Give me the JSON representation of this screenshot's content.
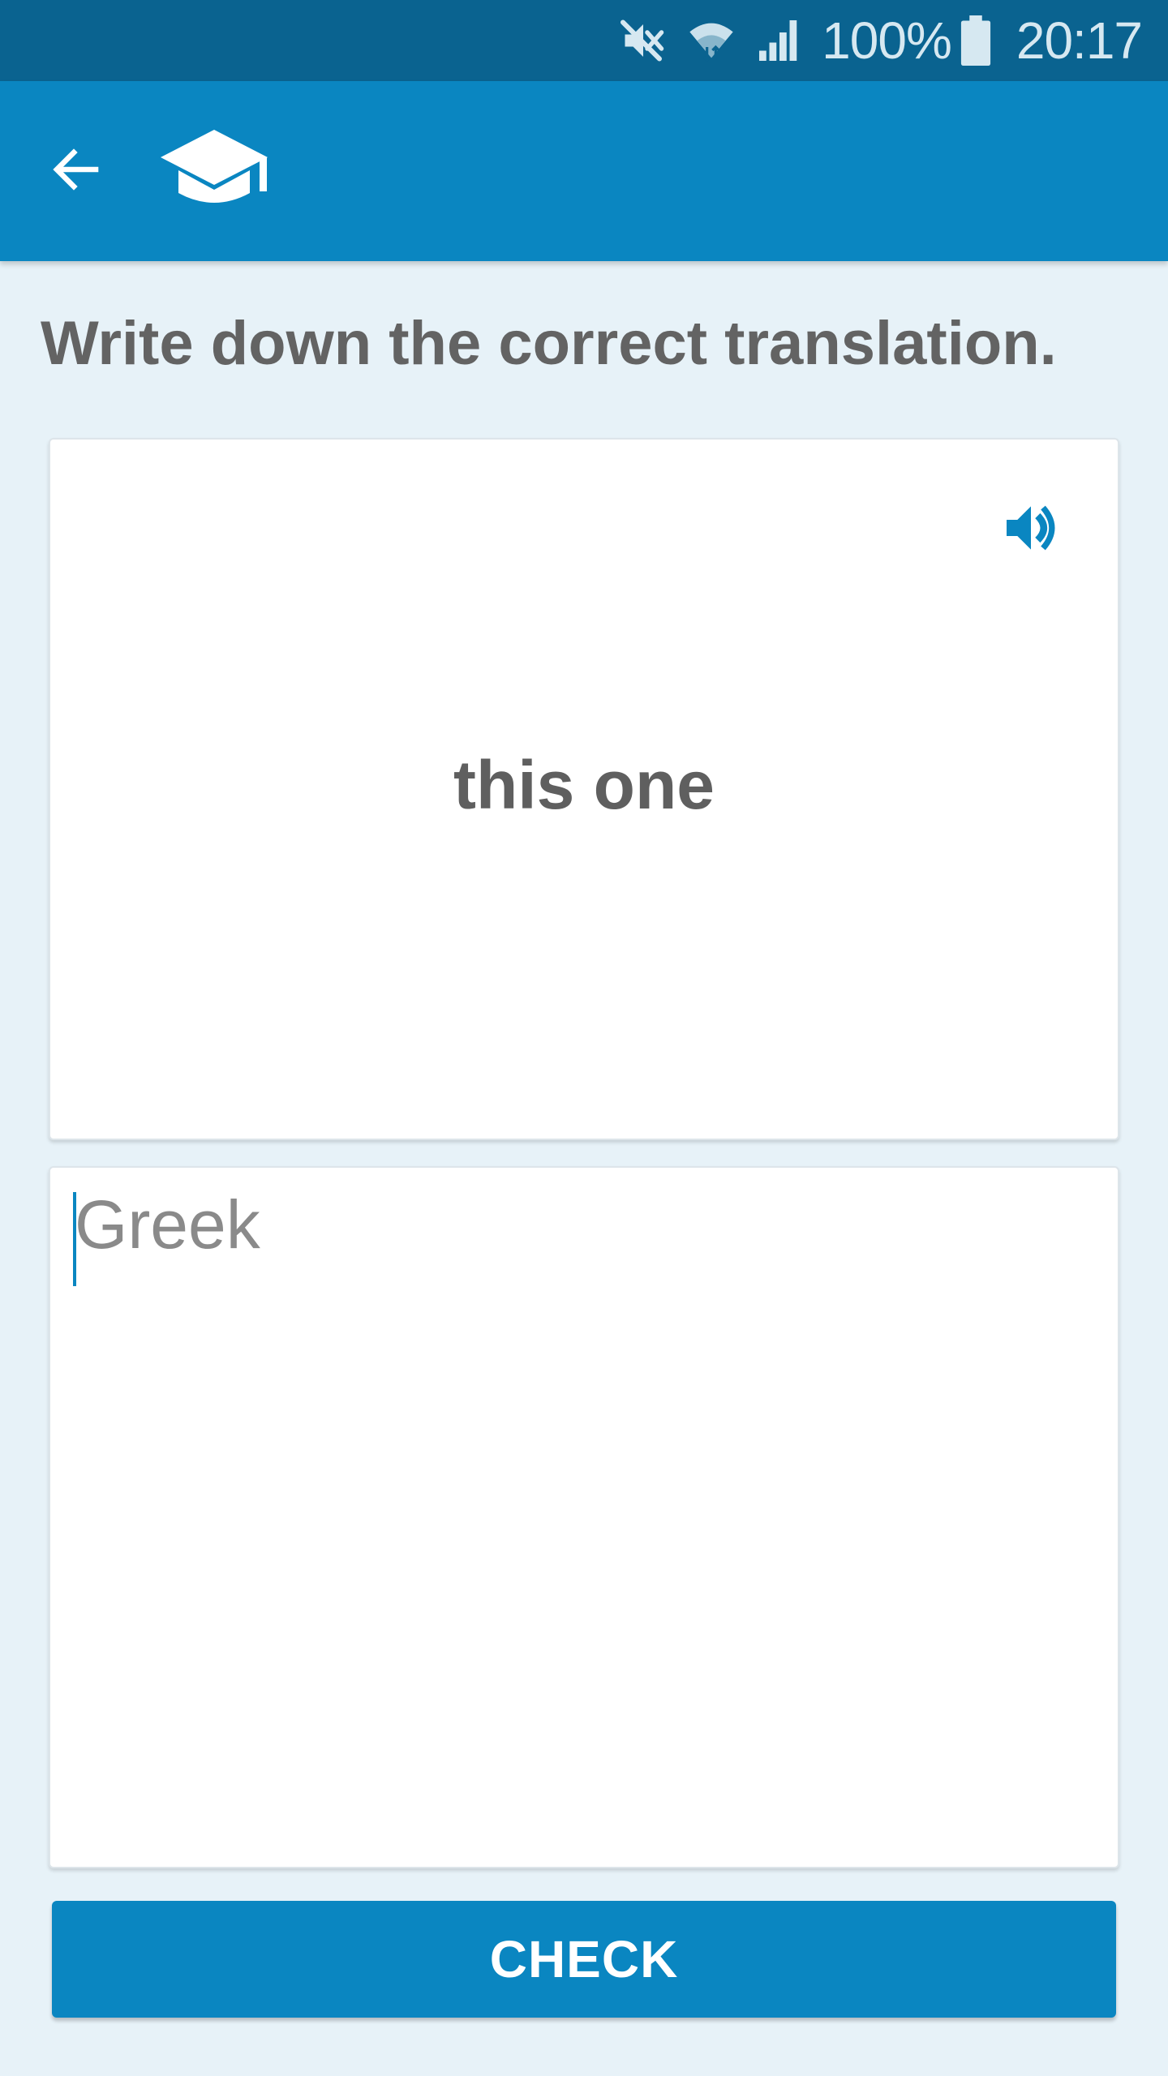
{
  "status_bar": {
    "battery_percent": "100%",
    "time": "20:17",
    "icons": [
      "mute-icon",
      "wifi-icon",
      "cell-signal-icon",
      "battery-icon"
    ]
  },
  "app_bar": {
    "back_icon": "arrow-left-icon",
    "logo_icon": "graduation-cap-icon"
  },
  "exercise": {
    "instruction": "Write down the correct translation.",
    "prompt_word": "this one",
    "speaker_icon": "speaker-icon",
    "answer": {
      "value": "",
      "placeholder": "Greek"
    },
    "check_label": "CHECK"
  },
  "colors": {
    "status_bar": "#0a6390",
    "primary": "#0a86c1",
    "background": "#e7f2f8",
    "text": "#636363"
  }
}
